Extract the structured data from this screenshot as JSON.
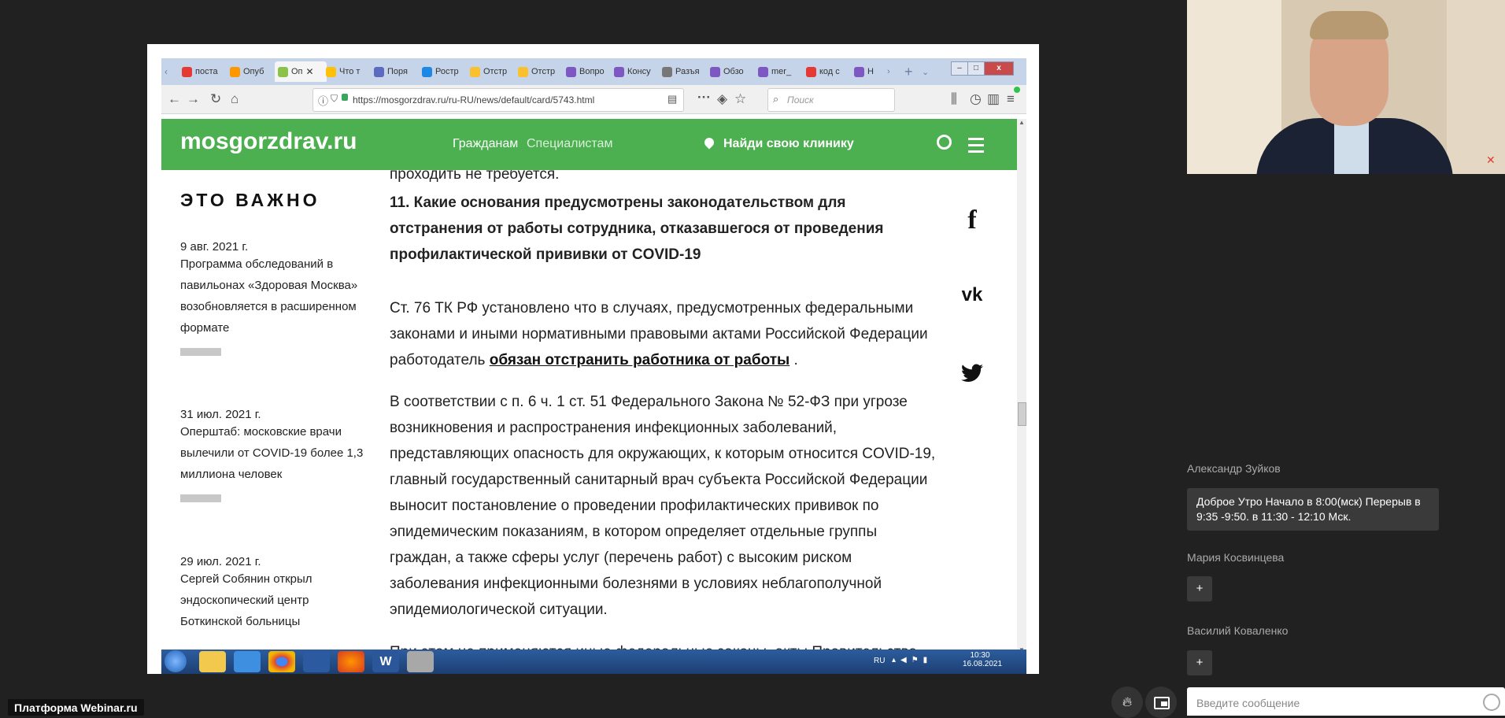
{
  "browser": {
    "tabs": [
      {
        "label": "поста",
        "color": "#e53935"
      },
      {
        "label": "Опуб",
        "color": "#ff9800"
      },
      {
        "label": "Оп",
        "color": "#8bc34a",
        "active": true
      },
      {
        "label": "Что т",
        "color": "#ffc107"
      },
      {
        "label": "Поря",
        "color": "#5c6bc0"
      },
      {
        "label": "Ростр",
        "color": "#1e88e5"
      },
      {
        "label": "Отстр",
        "color": "#fbc02d"
      },
      {
        "label": "Отстр",
        "color": "#fbc02d"
      },
      {
        "label": "Вопро",
        "color": "#7e57c2"
      },
      {
        "label": "Консу",
        "color": "#7e57c2"
      },
      {
        "label": "Разъя",
        "color": "#777777"
      },
      {
        "label": "Обзо",
        "color": "#7e57c2"
      },
      {
        "label": "mer_",
        "color": "#7e57c2"
      },
      {
        "label": "код с",
        "color": "#e53935"
      },
      {
        "label": "Н",
        "color": "#7e57c2"
      }
    ],
    "tab_close": "✕",
    "new_tab": "+",
    "url": "https://mosgorzdrav.ru/ru-RU/news/default/card/5743.html",
    "search_placeholder": "Поиск",
    "window_buttons": [
      "–",
      "□",
      "x"
    ]
  },
  "site": {
    "logo": "mosgorzdrav.ru",
    "nav_citizens": "Гражданам",
    "nav_specialists": "Специалистам",
    "find_clinic": "Найди свою клинику",
    "colors": {
      "header": "#4caf50"
    }
  },
  "sidebar": {
    "heading": "ЭТО ВАЖНО",
    "news": [
      {
        "date": "9 авг. 2021 г.",
        "title": "Программа обследований в павильонах «Здоровая Москва» возобновляется в расширенном формате"
      },
      {
        "date": "31 июл. 2021 г.",
        "title": "Оперштаб: московские врачи вылечили от COVID-19 более 1,3 миллиона человек"
      },
      {
        "date": "29 июл. 2021 г.",
        "title": "Сергей Собянин открыл эндоскопический центр Боткинской больницы"
      }
    ]
  },
  "article": {
    "prev_tail": "проходить не требуется.",
    "heading": "11. Какие основания предусмотрены законодательством для отстранения от работы сотрудника, отказавшегося от проведения профилактической прививки от COVID-19",
    "p1_pre": "Ст. 76 ТК РФ установлено что в случаях, предусмотренных федеральными законами и иными нормативными правовыми актами Российской Федерации работодатель ",
    "p1_link": "обязан отстранить работника от работы",
    "p1_post": " .",
    "p2": "В соответствии с п. 6 ч. 1 ст. 51 Федерального Закона № 52-ФЗ при угрозе возникновения и распространения инфекционных заболеваний, представляющих опасность для окружающих, к которым относится COVID-19, главный государственный санитарный врач субъекта Российской Федерации выносит постановление о проведении профилактических прививок по эпидемическим показаниям, в котором определяет отдельные группы граждан, а также сферы услуг (перечень работ) с высоким риском заболевания инфекционными болезнями в условиях неблагополучной эпидемиологической ситуации.",
    "p3_clipped": "При этом не применяются иные федеральные законы, акты Правительства"
  },
  "social": {
    "facebook": "f",
    "vk": "vk",
    "twitter": "twitter"
  },
  "taskbar": {
    "lang": "RU",
    "time": "10:30",
    "date": "16.08.2021"
  },
  "webinar": {
    "platform_badge": "Платформа Webinar.ru",
    "chat": [
      {
        "author": "Александр Зуйков",
        "message": "Доброе Утро Начало в 8:00(мск) Перерыв  в 9:35 -9:50.   в 11:30 - 12:10 Мск."
      },
      {
        "author": "Мария Косвинцева",
        "message": "+"
      },
      {
        "author": "Василий Коваленко",
        "message": "+"
      }
    ],
    "message_placeholder": "Введите сообщение",
    "icons": [
      "fire-icon",
      "picture-in-picture-icon",
      "emoji-icon",
      "mic-muted-icon"
    ]
  }
}
